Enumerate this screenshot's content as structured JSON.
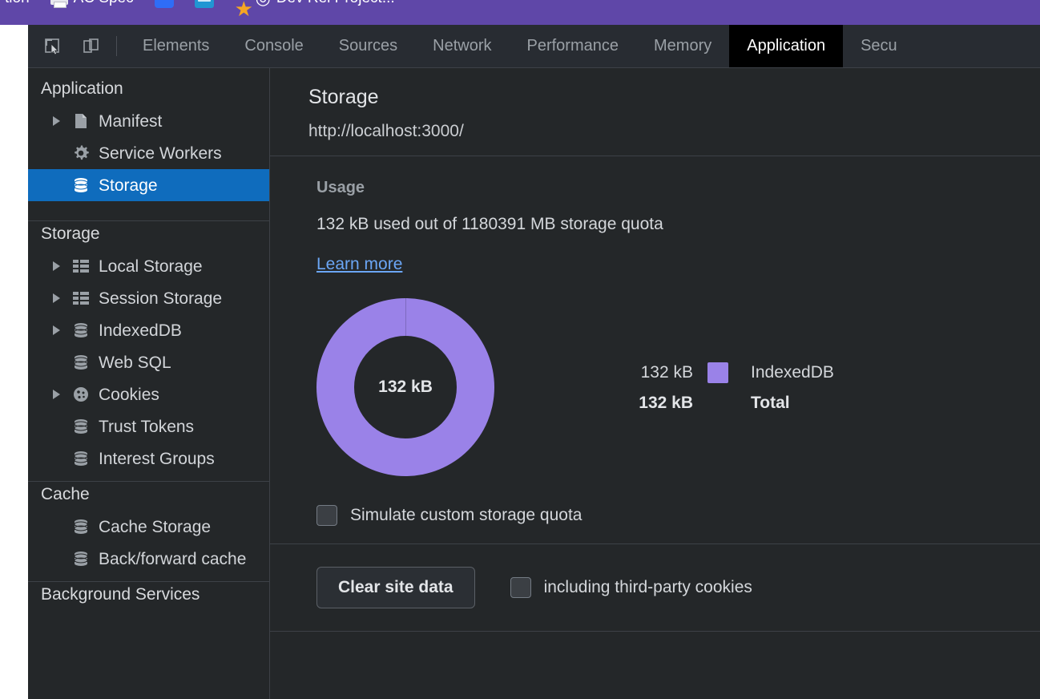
{
  "browser": {
    "bookmarks_bar": {
      "accent_color": "#5f47a8",
      "items": [
        {
          "label": "tion",
          "icon": "text-bookmark"
        },
        {
          "label": "AC Spec",
          "icon": "printer-icon"
        },
        {
          "label": "",
          "icon": "blue-app-icon"
        },
        {
          "label": "",
          "icon": "slides-icon"
        },
        {
          "label": "",
          "icon": "star-icon"
        },
        {
          "label": "Dev Rel Project...",
          "icon": "devrel-icon"
        }
      ]
    }
  },
  "devtools": {
    "toolbar": {
      "inspect_label": "Inspect element",
      "device_toolbar_label": "Toggle device toolbar",
      "tabs": [
        {
          "label": "Elements",
          "active": false
        },
        {
          "label": "Console",
          "active": false
        },
        {
          "label": "Sources",
          "active": false
        },
        {
          "label": "Network",
          "active": false
        },
        {
          "label": "Performance",
          "active": false
        },
        {
          "label": "Memory",
          "active": false
        },
        {
          "label": "Application",
          "active": true
        },
        {
          "label": "Secu",
          "active": false
        }
      ]
    },
    "sidebar": {
      "selected_color": "#0f6cbd",
      "groups": [
        {
          "title": "Application",
          "items": [
            {
              "label": "Manifest",
              "icon": "document-icon",
              "expandable": true,
              "selected": false
            },
            {
              "label": "Service Workers",
              "icon": "gear-icon",
              "expandable": false,
              "selected": false
            },
            {
              "label": "Storage",
              "icon": "database-icon",
              "expandable": false,
              "selected": true
            }
          ]
        },
        {
          "title": "Storage",
          "items": [
            {
              "label": "Local Storage",
              "icon": "table-icon",
              "expandable": true,
              "selected": false
            },
            {
              "label": "Session Storage",
              "icon": "table-icon",
              "expandable": true,
              "selected": false
            },
            {
              "label": "IndexedDB",
              "icon": "database-icon",
              "expandable": true,
              "selected": false
            },
            {
              "label": "Web SQL",
              "icon": "database-icon",
              "expandable": false,
              "selected": false
            },
            {
              "label": "Cookies",
              "icon": "cookie-icon",
              "expandable": true,
              "selected": false
            },
            {
              "label": "Trust Tokens",
              "icon": "database-icon",
              "expandable": false,
              "selected": false
            },
            {
              "label": "Interest Groups",
              "icon": "database-icon",
              "expandable": false,
              "selected": false
            }
          ]
        },
        {
          "title": "Cache",
          "items": [
            {
              "label": "Cache Storage",
              "icon": "database-icon",
              "expandable": false,
              "selected": false
            },
            {
              "label": "Back/forward cache",
              "icon": "database-icon",
              "expandable": false,
              "selected": false
            }
          ]
        },
        {
          "title": "Background Services",
          "items": []
        }
      ]
    },
    "main": {
      "title": "Storage",
      "origin": "http://localhost:3000/",
      "usage": {
        "heading": "Usage",
        "summary": "132 kB used out of 1180391 MB storage quota",
        "learn_more_label": "Learn more",
        "center_label": "132 kB",
        "simulate_quota_label": "Simulate custom storage quota",
        "simulate_quota_checked": false
      },
      "clear": {
        "button_label": "Clear site data",
        "third_party_label": "including third-party cookies",
        "third_party_checked": false
      }
    }
  },
  "chart_data": {
    "type": "pie",
    "variant": "donut",
    "title": "Usage",
    "center_label": "132 kB",
    "categories": [
      "IndexedDB"
    ],
    "values": [
      132
    ],
    "value_labels": [
      "132 kB"
    ],
    "unit": "kB",
    "colors": [
      "#9a82e8"
    ],
    "total": 132,
    "total_label": "132 kB",
    "total_name": "Total",
    "legend_position": "right",
    "legend": [
      {
        "value_label": "132 kB",
        "name": "IndexedDB",
        "color": "#9a82e8",
        "bold": false
      },
      {
        "value_label": "132 kB",
        "name": "Total",
        "color": null,
        "bold": true
      }
    ]
  }
}
